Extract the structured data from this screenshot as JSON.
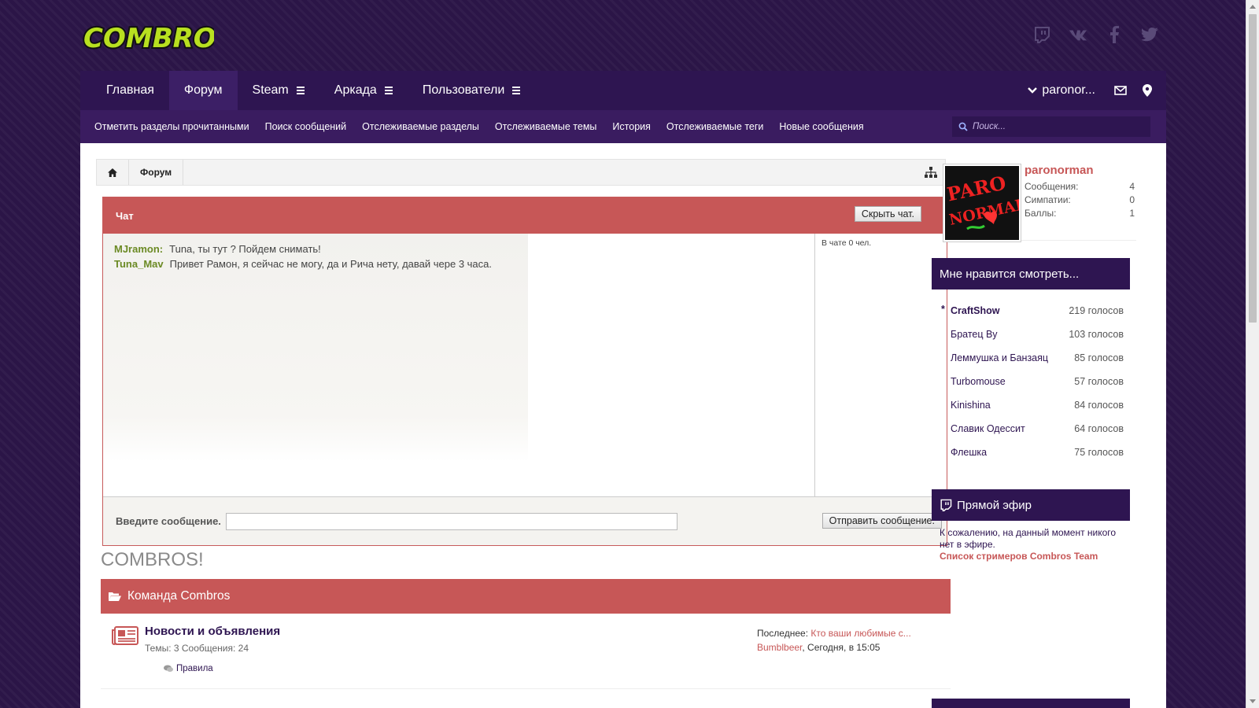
{
  "brand": {
    "logo_text": "COMBROS"
  },
  "nav": {
    "tabs": [
      {
        "label": "Главная"
      },
      {
        "label": "Форум"
      },
      {
        "label": "Steam"
      },
      {
        "label": "Аркада"
      },
      {
        "label": "Пользователи"
      }
    ],
    "username": "paronor..."
  },
  "subnav": {
    "links": [
      "Отметить разделы прочитанными",
      "Поиск сообщений",
      "Отслеживаемые разделы",
      "Отслеживаемые темы",
      "История",
      "Отслеживаемые теги",
      "Новые сообщения"
    ],
    "search_placeholder": "Поиск..."
  },
  "breadcrumb": {
    "current": "Форум"
  },
  "chat": {
    "title": "Чат",
    "hide_button": "Скрыть чат.",
    "messages": [
      {
        "nick": "MJramon:",
        "text": "Tuna, ты тут ? Пойдем снимать!"
      },
      {
        "nick": "Tuna_Mav",
        "text": "Привет Рамон, я сейчас не могу, да и Рича нету, давай чере 3 часа."
      }
    ],
    "online": "В чате 0 чел.",
    "input_label": "Введите сообщение.",
    "send_button": "Отправить сообщение."
  },
  "section": {
    "title": "COMBROS!",
    "category": "Команда Combros",
    "forum": {
      "title": "Новости и объявления",
      "stats": "Темы: 3 Сообщения: 24",
      "sub": "Правила",
      "last_label": "Последнее:",
      "last_link": "Кто ваши любимые с...",
      "last_user": "Bumblbeer",
      "last_time": ", Сегодня, в 15:05"
    }
  },
  "profile": {
    "name": "paronorman",
    "stats": [
      {
        "label": "Сообщения:",
        "value": "4"
      },
      {
        "label": "Симпатии:",
        "value": "0"
      },
      {
        "label": "Баллы:",
        "value": "1"
      }
    ],
    "avatar_text_1": "PARO",
    "avatar_text_2": "NORMAL"
  },
  "poll": {
    "title": "Мне нравится смотреть...",
    "items": [
      {
        "name": "CraftShow",
        "votes": "219 голосов"
      },
      {
        "name": "Братец Ву",
        "votes": "103 голосов"
      },
      {
        "name": "Леммушка и Банзаяц",
        "votes": "85 голосов"
      },
      {
        "name": "Turbomouse",
        "votes": "57 голосов"
      },
      {
        "name": "Kinishina",
        "votes": "84 голосов"
      },
      {
        "name": "Славик Одессит",
        "votes": "64 голосов"
      },
      {
        "name": "Флешка",
        "votes": "75 голосов"
      }
    ]
  },
  "live": {
    "title": "Прямой эфир",
    "text": "К сожалению, на данный момент никого нет в эфире.",
    "link": "Список стримеров Combros Team"
  },
  "colors": {
    "brand_purple": "#2e1551",
    "accent_red": "#c75757",
    "nick_green": "#6b8a24"
  }
}
